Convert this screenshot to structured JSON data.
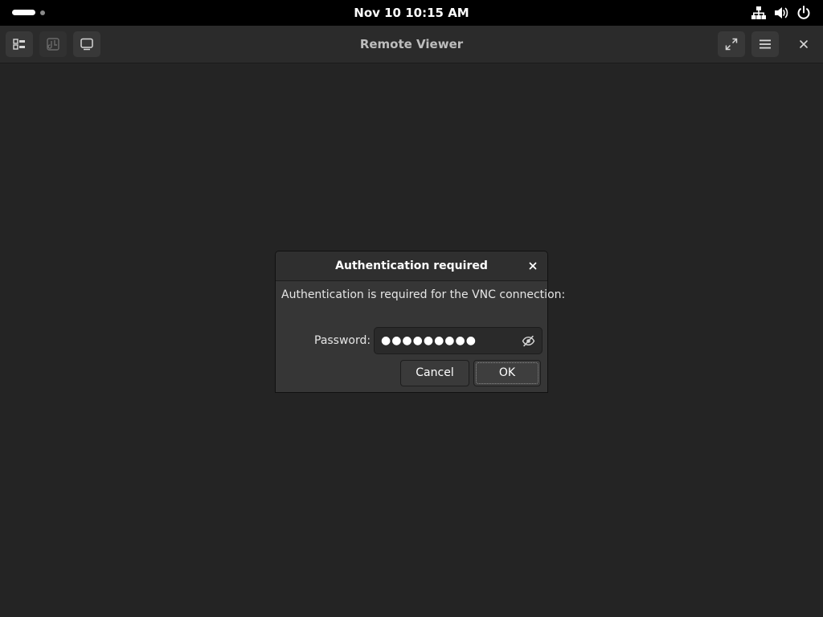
{
  "top_bar": {
    "clock": "Nov 10  10:15 AM",
    "icons": [
      "network-wired-icon",
      "volume-icon",
      "power-icon"
    ]
  },
  "headerbar": {
    "title": "Remote Viewer",
    "left_buttons": [
      "grid-view-icon",
      "send-keys-icon",
      "display-icon"
    ],
    "right_buttons": [
      "fullscreen-icon",
      "hamburger-menu-icon",
      "close-icon"
    ]
  },
  "dialog": {
    "title": "Authentication required",
    "message": "Authentication is required for the VNC connection:",
    "password_label": "Password:",
    "password_value": "●●●●●●●●●",
    "cancel_label": "Cancel",
    "ok_label": "OK"
  },
  "colors": {
    "background": "#242424",
    "topbar": "#000000",
    "headerbar": "#2b2b2b",
    "dialog": "#363636"
  }
}
